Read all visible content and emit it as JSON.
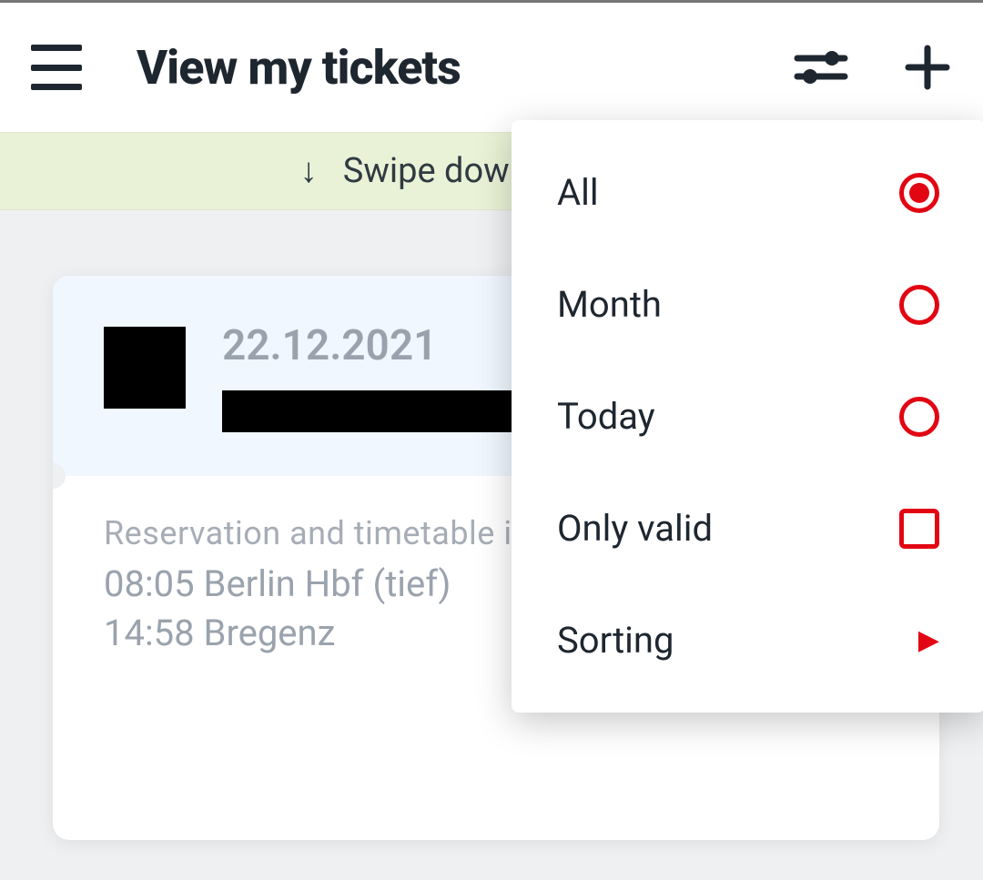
{
  "header": {
    "title": "View my tickets"
  },
  "banner": {
    "text": "Swipe down to update"
  },
  "ticket": {
    "date": "22.12.2021",
    "info_label": "Reservation and timetable info",
    "dep_time": "08:05",
    "dep_station": "Berlin Hbf (tief)",
    "arr_time": "14:58",
    "arr_station": "Bregenz"
  },
  "filter_menu": {
    "items": [
      {
        "label": "All",
        "type": "radio",
        "selected": true
      },
      {
        "label": "Month",
        "type": "radio",
        "selected": false
      },
      {
        "label": "Today",
        "type": "radio",
        "selected": false
      },
      {
        "label": "Only valid",
        "type": "checkbox",
        "selected": false
      },
      {
        "label": "Sorting",
        "type": "submenu"
      }
    ]
  },
  "colors": {
    "accent": "#e20613"
  }
}
